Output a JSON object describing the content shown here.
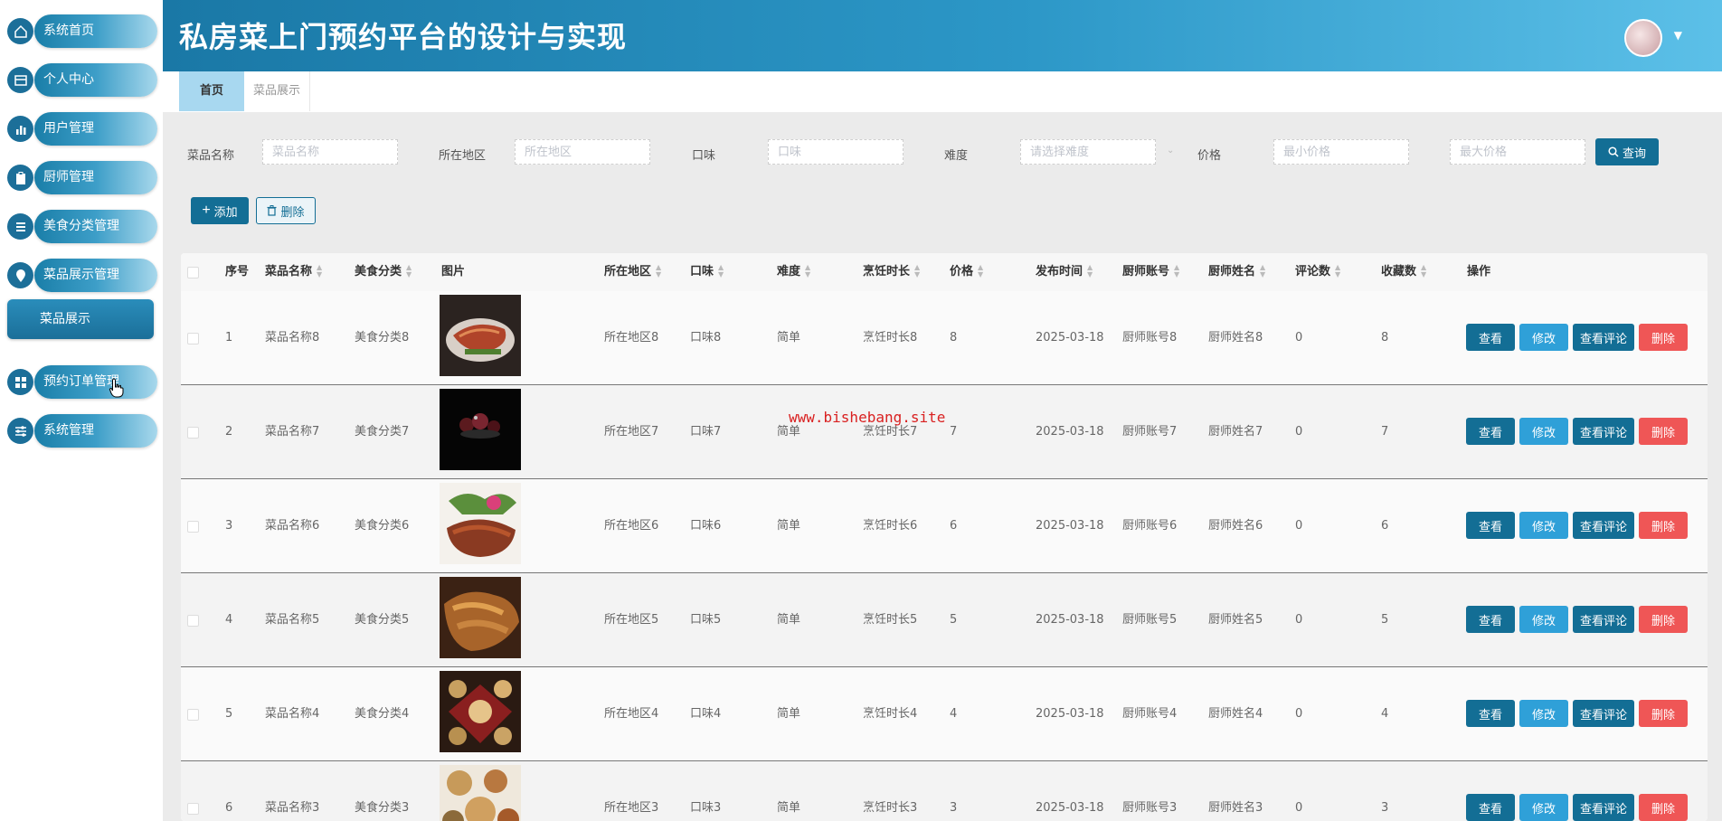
{
  "app": {
    "title": "私房菜上门预约平台的设计与实现"
  },
  "sidebar": {
    "items": [
      {
        "label": "系统首页",
        "icon": "home-icon"
      },
      {
        "label": "个人中心",
        "icon": "profile-icon"
      },
      {
        "label": "用户管理",
        "icon": "chart-icon"
      },
      {
        "label": "厨师管理",
        "icon": "clipboard-icon"
      },
      {
        "label": "美食分类管理",
        "icon": "list-icon"
      },
      {
        "label": "菜品展示管理",
        "icon": "pin-icon"
      },
      {
        "label": "预约订单管理",
        "icon": "grid-icon"
      },
      {
        "label": "系统管理",
        "icon": "sliders-icon"
      }
    ],
    "active_sub": "菜品展示"
  },
  "tabs": {
    "home": "首页",
    "dish": "菜品展示"
  },
  "filters": {
    "dish_name": {
      "label": "菜品名称",
      "placeholder": "菜品名称"
    },
    "region": {
      "label": "所在地区",
      "placeholder": "所在地区"
    },
    "taste": {
      "label": "口味",
      "placeholder": "口味"
    },
    "difficulty": {
      "label": "难度",
      "placeholder": "请选择难度"
    },
    "price": {
      "label": "价格",
      "min_placeholder": "最小价格",
      "max_placeholder": "最大价格"
    },
    "query_button": "查询"
  },
  "toolbar": {
    "add": "添加",
    "delete": "删除"
  },
  "table": {
    "headers": [
      "序号",
      "菜品名称",
      "美食分类",
      "图片",
      "所在地区",
      "口味",
      "难度",
      "烹饪时长",
      "价格",
      "发布时间",
      "厨师账号",
      "厨师姓名",
      "评论数",
      "收藏数",
      "操作"
    ],
    "actions": {
      "view": "查看",
      "edit": "修改",
      "comments": "查看评论",
      "delete": "删除"
    },
    "rows": [
      {
        "idx": "1",
        "name": "菜品名称8",
        "category": "美食分类8",
        "region": "所在地区8",
        "taste": "口味8",
        "difficulty": "简单",
        "cook_time": "烹饪时长8",
        "price": "8",
        "date": "2025-03-18",
        "chef_account": "厨师账号8",
        "chef_name": "厨师姓名8",
        "comments": "0",
        "favorites": "8"
      },
      {
        "idx": "2",
        "name": "菜品名称7",
        "category": "美食分类7",
        "region": "所在地区7",
        "taste": "口味7",
        "difficulty": "简单",
        "cook_time": "烹饪时长7",
        "price": "7",
        "date": "2025-03-18",
        "chef_account": "厨师账号7",
        "chef_name": "厨师姓名7",
        "comments": "0",
        "favorites": "7"
      },
      {
        "idx": "3",
        "name": "菜品名称6",
        "category": "美食分类6",
        "region": "所在地区6",
        "taste": "口味6",
        "difficulty": "简单",
        "cook_time": "烹饪时长6",
        "price": "6",
        "date": "2025-03-18",
        "chef_account": "厨师账号6",
        "chef_name": "厨师姓名6",
        "comments": "0",
        "favorites": "6"
      },
      {
        "idx": "4",
        "name": "菜品名称5",
        "category": "美食分类5",
        "region": "所在地区5",
        "taste": "口味5",
        "difficulty": "简单",
        "cook_time": "烹饪时长5",
        "price": "5",
        "date": "2025-03-18",
        "chef_account": "厨师账号5",
        "chef_name": "厨师姓名5",
        "comments": "0",
        "favorites": "5"
      },
      {
        "idx": "5",
        "name": "菜品名称4",
        "category": "美食分类4",
        "region": "所在地区4",
        "taste": "口味4",
        "difficulty": "简单",
        "cook_time": "烹饪时长4",
        "price": "4",
        "date": "2025-03-18",
        "chef_account": "厨师账号4",
        "chef_name": "厨师姓名4",
        "comments": "0",
        "favorites": "4"
      },
      {
        "idx": "6",
        "name": "菜品名称3",
        "category": "美食分类3",
        "region": "所在地区3",
        "taste": "口味3",
        "difficulty": "简单",
        "cook_time": "烹饪时长3",
        "price": "3",
        "date": "2025-03-18",
        "chef_account": "厨师账号3",
        "chef_name": "厨师姓名3",
        "comments": "0",
        "favorites": "3"
      }
    ]
  },
  "watermark": "www.bishebang.site",
  "colors": {
    "primary": "#136e95",
    "edit": "#2fa0d8",
    "danger": "#ef5656",
    "header_start": "#1a78a6",
    "header_end": "#5cc0e8"
  }
}
